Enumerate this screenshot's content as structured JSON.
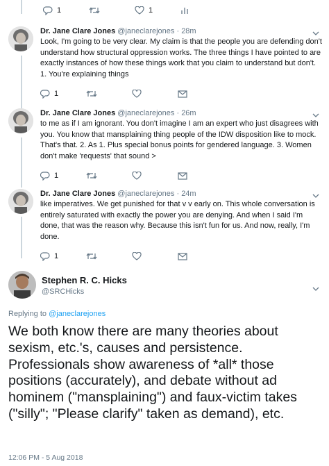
{
  "top_actions": {
    "reply_count": "1",
    "retweet_count": "",
    "like_count": "1"
  },
  "replies": [
    {
      "name": "Dr. Jane Clare Jones",
      "handle": "@janeclarejones",
      "time": "· 28m",
      "text": "Look, I'm going to be very clear. My claim is that the people you are defending don't understand how structural oppression works. The three things I have pointed to are exactly instances of how these things work that you claim to understand but don't. 1. You're explaining things",
      "reply_count": "1"
    },
    {
      "name": "Dr. Jane Clare Jones",
      "handle": "@janeclarejones",
      "time": "· 26m",
      "text": "to me as if I am ignorant. You don't imagine I am an expert who just disagrees with you. You know that mansplaining thing people of the IDW disposition like to mock. That's that. 2. As 1. Plus special bonus points for gendered language. 3. Women don't make 'requests' that sound >",
      "reply_count": "1"
    },
    {
      "name": "Dr. Jane Clare Jones",
      "handle": "@janeclarejones",
      "time": "· 24m",
      "text": "like imperatives. We get punished for that v v early on. This whole conversation is entirely saturated with exactly the power you are denying. And when I said I'm done, that was the reason why. Because this isn't fun for us. And now, really, I'm done.",
      "reply_count": "1"
    }
  ],
  "main_tweet": {
    "name": "Stephen R. C. Hicks",
    "handle": "@SRCHicks",
    "replying_prefix": "Replying to ",
    "replying_to": "@janeclarejones",
    "text": "We both know there are many theories about sexism, etc.'s, causes and persistence. Professionals show awareness of *all* those positions (accurately), and debate without ad hominem (\"mansplaining\") and faux-victim takes (\"silly\"; \"Please clarify\" taken as demand), etc.",
    "timestamp": "12:06 PM - 5 Aug 2018"
  },
  "icons": {
    "reply": "reply-icon",
    "retweet": "retweet-icon",
    "like": "heart-icon",
    "message": "envelope-icon",
    "analytics": "analytics-icon",
    "caret": "chevron-down-icon"
  },
  "colors": {
    "text": "#14171a",
    "secondary": "#657786",
    "link": "#1da1f2",
    "thread_line": "#ccd6dd"
  }
}
